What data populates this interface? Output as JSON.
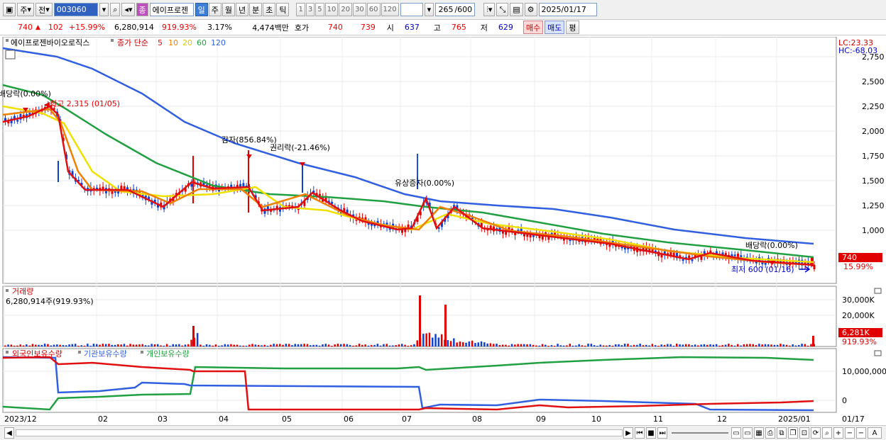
{
  "toolbar": {
    "market": "주",
    "all": "전",
    "code": "003060",
    "stock_name": "에이프로젠",
    "badge": "종",
    "periods": [
      "일",
      "주",
      "월",
      "년",
      "분",
      "초",
      "틱"
    ],
    "active_period": "일",
    "intervals": [
      "1",
      "3",
      "5",
      "10",
      "20",
      "30",
      "60",
      "120"
    ],
    "count": "265",
    "count_total": "/600",
    "date": "2025/01/17"
  },
  "quote": {
    "price": "740",
    "change": "102",
    "change_pct": "+15.99%",
    "volume": "6,280,914",
    "vol_ratio": "919.93%",
    "turnover": "3.17%",
    "amount": "4,474백만",
    "bid_label": "호가",
    "ask": "740",
    "bid": "739",
    "open_label": "시",
    "open": "637",
    "high_label": "고",
    "high": "765",
    "low_label": "저",
    "low": "629",
    "buy": "매수",
    "sell": "매도",
    "eval": "평"
  },
  "main_panel": {
    "stock_label": "에이프로젠바이오로직스",
    "ma_label": "종가 단순",
    "ma_periods": [
      "5",
      "10",
      "20",
      "60",
      "120"
    ],
    "lc": "LC:23.33",
    "hc": "HC:-68.03",
    "y_ticks": [
      "2,750",
      "2,500",
      "2,250",
      "2,000",
      "1,750",
      "1,500",
      "1,250",
      "1,000"
    ],
    "price_tag": "740",
    "pct_tag": "15.99%",
    "annotations": {
      "dividend1": "배당락(0.00%)",
      "high": "최고 2,315 (01/05)",
      "capital_reduction": "감자(856.84%)",
      "rights": "권리락(-21.46%)",
      "capital_increase": "유상증자(0.00%)",
      "dividend2": "배당락(0.00%)",
      "low": "최저 600 (01/16)"
    }
  },
  "volume_panel": {
    "title": "거래량",
    "value": "6,280,914주(919.93%)",
    "y_ticks": [
      "30,000K",
      "20,000K"
    ],
    "tag": "6,281K",
    "pct": "919.93%"
  },
  "holding_panel": {
    "foreign": "외국인보유수량",
    "institution": "기관보유수량",
    "individual": "개인보유수량",
    "y_ticks": [
      "10,000,000",
      "0"
    ]
  },
  "x_axis": [
    "2023/12",
    "02",
    "03",
    "04",
    "05",
    "06",
    "07",
    "08",
    "09",
    "10",
    "11",
    "12",
    "2025/01",
    "01/17"
  ],
  "colors": {
    "ma5": "#e01010",
    "ma10": "#f08000",
    "ma20": "#f0e000",
    "ma60": "#20a040",
    "ma120": "#3060e0",
    "up": "#e00000",
    "down": "#1040d0"
  }
}
